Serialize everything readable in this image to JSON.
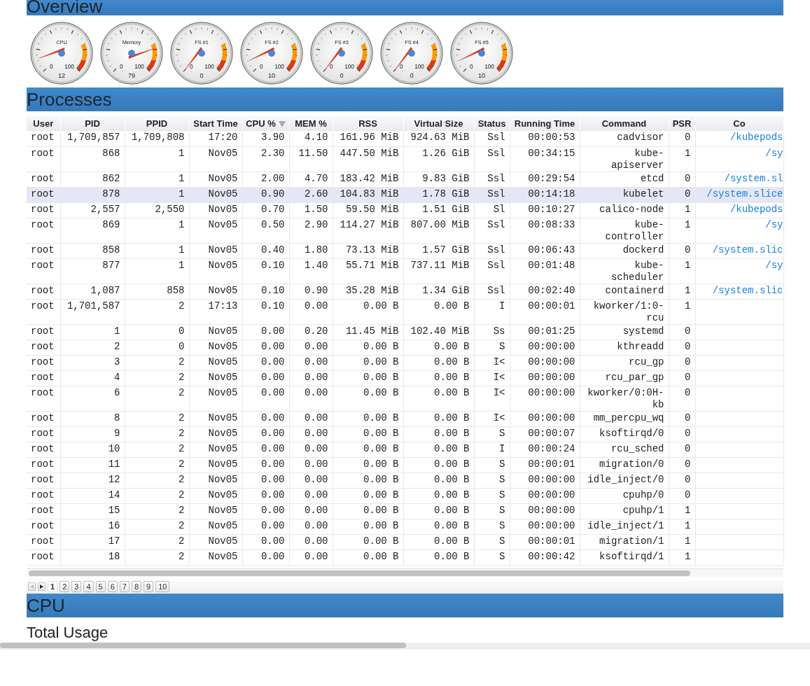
{
  "overview": {
    "title": "Overview",
    "gauges": [
      {
        "label": "CPU",
        "value": "12",
        "min": "0",
        "max": "100"
      },
      {
        "label": "Memory",
        "value": "79",
        "min": "0",
        "max": "100"
      },
      {
        "label": "FS #1",
        "value": "0",
        "min": "0",
        "max": "100"
      },
      {
        "label": "FS #2",
        "value": "10",
        "min": "0",
        "max": "100"
      },
      {
        "label": "FS #3",
        "value": "0",
        "min": "0",
        "max": "100"
      },
      {
        "label": "FS #4",
        "value": "0",
        "min": "0",
        "max": "100"
      },
      {
        "label": "FS #5",
        "value": "10",
        "min": "0",
        "max": "100"
      }
    ]
  },
  "processes": {
    "title": "Processes",
    "columns": [
      {
        "label": "User",
        "sorted": false
      },
      {
        "label": "PID",
        "sorted": false
      },
      {
        "label": "PPID",
        "sorted": false
      },
      {
        "label": "Start Time",
        "sorted": false
      },
      {
        "label": "CPU %",
        "sorted": true
      },
      {
        "label": "MEM %",
        "sorted": false
      },
      {
        "label": "RSS",
        "sorted": false
      },
      {
        "label": "Virtual Size",
        "sorted": false
      },
      {
        "label": "Status",
        "sorted": false
      },
      {
        "label": "Running Time",
        "sorted": false
      },
      {
        "label": "Command",
        "sorted": false
      },
      {
        "label": "PSR",
        "sorted": false
      },
      {
        "label": "Co",
        "sorted": false
      }
    ],
    "rows": [
      {
        "selected": false,
        "cells": [
          "root",
          "1,709,857",
          "1,709,808",
          "17:20",
          "3.90",
          "4.10",
          "161.96 MiB",
          "924.63 MiB",
          "Ssl",
          "00:00:53",
          "cadvisor",
          "0",
          "/kubepods"
        ]
      },
      {
        "selected": false,
        "cells": [
          "root",
          "868",
          "1",
          "Nov05",
          "2.30",
          "11.50",
          "447.50 MiB",
          "1.26 GiB",
          "Ssl",
          "00:34:15",
          "kube-apiserver",
          "1",
          "/sy"
        ]
      },
      {
        "selected": false,
        "cells": [
          "root",
          "862",
          "1",
          "Nov05",
          "2.00",
          "4.70",
          "183.42 MiB",
          "9.83 GiB",
          "Ssl",
          "00:29:54",
          "etcd",
          "0",
          "/system.sl"
        ]
      },
      {
        "selected": true,
        "cells": [
          "root",
          "878",
          "1",
          "Nov05",
          "0.90",
          "2.60",
          "104.83 MiB",
          "1.78 GiB",
          "Ssl",
          "00:14:18",
          "kubelet",
          "0",
          "/system.slice"
        ]
      },
      {
        "selected": false,
        "cells": [
          "root",
          "2,557",
          "2,550",
          "Nov05",
          "0.70",
          "1.50",
          "59.50 MiB",
          "1.51 GiB",
          "Sl",
          "00:10:27",
          "calico-node",
          "1",
          "/kubepods"
        ]
      },
      {
        "selected": false,
        "cells": [
          "root",
          "869",
          "1",
          "Nov05",
          "0.50",
          "2.90",
          "114.27 MiB",
          "807.00 MiB",
          "Ssl",
          "00:08:33",
          "kube-controller",
          "1",
          "/sy"
        ]
      },
      {
        "selected": false,
        "cells": [
          "root",
          "858",
          "1",
          "Nov05",
          "0.40",
          "1.80",
          "73.13 MiB",
          "1.57 GiB",
          "Ssl",
          "00:06:43",
          "dockerd",
          "0",
          "/system.slic"
        ]
      },
      {
        "selected": false,
        "cells": [
          "root",
          "877",
          "1",
          "Nov05",
          "0.10",
          "1.40",
          "55.71 MiB",
          "737.11 MiB",
          "Ssl",
          "00:01:48",
          "kube-scheduler",
          "1",
          "/sy"
        ]
      },
      {
        "selected": false,
        "cells": [
          "root",
          "1,087",
          "858",
          "Nov05",
          "0.10",
          "0.90",
          "35.28 MiB",
          "1.34 GiB",
          "Ssl",
          "00:02:40",
          "containerd",
          "1",
          "/system.slic"
        ]
      },
      {
        "selected": false,
        "cells": [
          "root",
          "1,701,587",
          "2",
          "17:13",
          "0.10",
          "0.00",
          "0.00 B",
          "0.00 B",
          "I",
          "00:00:01",
          "kworker/1:0-rcu",
          "1"
        ]
      },
      {
        "selected": false,
        "cells": [
          "root",
          "1",
          "0",
          "Nov05",
          "0.00",
          "0.20",
          "11.45 MiB",
          "102.40 MiB",
          "Ss",
          "00:01:25",
          "systemd",
          "0"
        ]
      },
      {
        "selected": false,
        "cells": [
          "root",
          "2",
          "0",
          "Nov05",
          "0.00",
          "0.00",
          "0.00 B",
          "0.00 B",
          "S",
          "00:00:00",
          "kthreadd",
          "0"
        ]
      },
      {
        "selected": false,
        "cells": [
          "root",
          "3",
          "2",
          "Nov05",
          "0.00",
          "0.00",
          "0.00 B",
          "0.00 B",
          "I<",
          "00:00:00",
          "rcu_gp",
          "0"
        ]
      },
      {
        "selected": false,
        "cells": [
          "root",
          "4",
          "2",
          "Nov05",
          "0.00",
          "0.00",
          "0.00 B",
          "0.00 B",
          "I<",
          "00:00:00",
          "rcu_par_gp",
          "0"
        ]
      },
      {
        "selected": false,
        "cells": [
          "root",
          "6",
          "2",
          "Nov05",
          "0.00",
          "0.00",
          "0.00 B",
          "0.00 B",
          "I<",
          "00:00:00",
          "kworker/0:0H-kb",
          "0"
        ]
      },
      {
        "selected": false,
        "cells": [
          "root",
          "8",
          "2",
          "Nov05",
          "0.00",
          "0.00",
          "0.00 B",
          "0.00 B",
          "I<",
          "00:00:00",
          "mm_percpu_wq",
          "0"
        ]
      },
      {
        "selected": false,
        "cells": [
          "root",
          "9",
          "2",
          "Nov05",
          "0.00",
          "0.00",
          "0.00 B",
          "0.00 B",
          "S",
          "00:00:07",
          "ksoftirqd/0",
          "0"
        ]
      },
      {
        "selected": false,
        "cells": [
          "root",
          "10",
          "2",
          "Nov05",
          "0.00",
          "0.00",
          "0.00 B",
          "0.00 B",
          "I",
          "00:00:24",
          "rcu_sched",
          "0"
        ]
      },
      {
        "selected": false,
        "cells": [
          "root",
          "11",
          "2",
          "Nov05",
          "0.00",
          "0.00",
          "0.00 B",
          "0.00 B",
          "S",
          "00:00:01",
          "migration/0",
          "0"
        ]
      },
      {
        "selected": false,
        "cells": [
          "root",
          "12",
          "2",
          "Nov05",
          "0.00",
          "0.00",
          "0.00 B",
          "0.00 B",
          "S",
          "00:00:00",
          "idle_inject/0",
          "0"
        ]
      },
      {
        "selected": false,
        "cells": [
          "root",
          "14",
          "2",
          "Nov05",
          "0.00",
          "0.00",
          "0.00 B",
          "0.00 B",
          "S",
          "00:00:00",
          "cpuhp/0",
          "0"
        ]
      },
      {
        "selected": false,
        "cells": [
          "root",
          "15",
          "2",
          "Nov05",
          "0.00",
          "0.00",
          "0.00 B",
          "0.00 B",
          "S",
          "00:00:00",
          "cpuhp/1",
          "1"
        ]
      },
      {
        "selected": false,
        "cells": [
          "root",
          "16",
          "2",
          "Nov05",
          "0.00",
          "0.00",
          "0.00 B",
          "0.00 B",
          "S",
          "00:00:00",
          "idle_inject/1",
          "1"
        ]
      },
      {
        "selected": false,
        "cells": [
          "root",
          "17",
          "2",
          "Nov05",
          "0.00",
          "0.00",
          "0.00 B",
          "0.00 B",
          "S",
          "00:00:01",
          "migration/1",
          "1"
        ]
      },
      {
        "selected": false,
        "cells": [
          "root",
          "18",
          "2",
          "Nov05",
          "0.00",
          "0.00",
          "0.00 B",
          "0.00 B",
          "S",
          "00:00:42",
          "ksoftirqd/1",
          "1"
        ]
      }
    ],
    "pages": [
      {
        "label": "1",
        "selected": true
      },
      {
        "label": "2",
        "selected": false
      },
      {
        "label": "3",
        "selected": false
      },
      {
        "label": "4",
        "selected": false
      },
      {
        "label": "5",
        "selected": false
      },
      {
        "label": "6",
        "selected": false
      },
      {
        "label": "7",
        "selected": false
      },
      {
        "label": "8",
        "selected": false
      },
      {
        "label": "9",
        "selected": false
      },
      {
        "label": "10",
        "selected": false
      }
    ]
  },
  "cpu": {
    "title": "CPU",
    "subtitle": "Total Usage"
  }
}
